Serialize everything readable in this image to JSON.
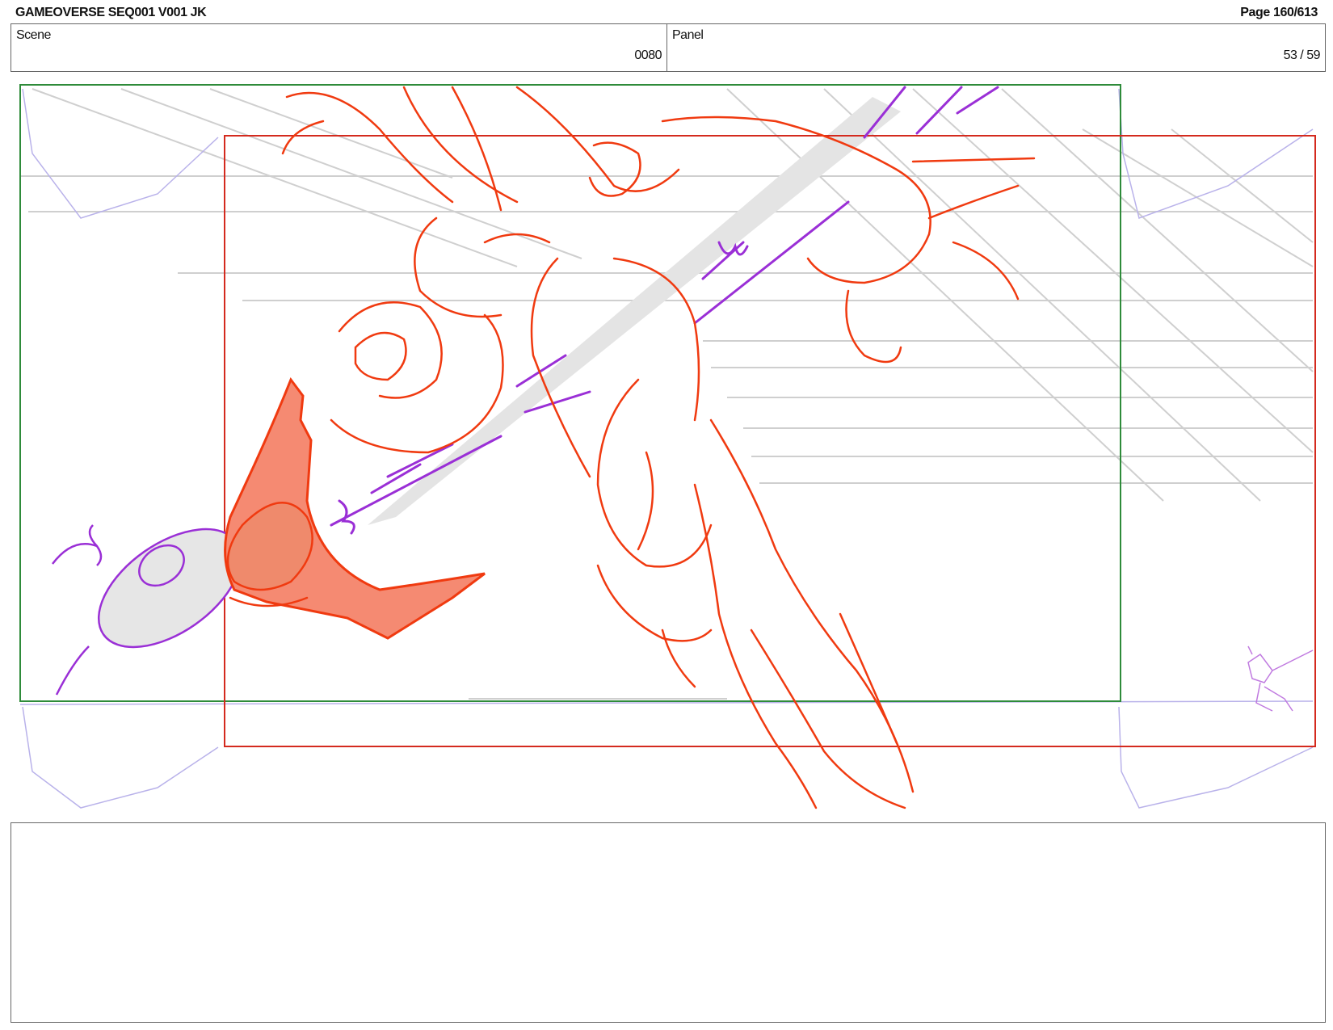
{
  "header": {
    "title": "GAMEOVERSE SEQ001 V001 JK",
    "page": "Page 160/613"
  },
  "info": {
    "scene_label": "Scene",
    "scene_value": "0080",
    "panel_label": "Panel",
    "panel_value": "53 / 59"
  },
  "panel": {
    "description_text": ""
  },
  "colors": {
    "camera_frame": "#2e8b3a",
    "field_frame": "#d42a1e",
    "sketch_red": "#f03a10",
    "sketch_fill": "#f58a72",
    "sketch_purple": "#9a2fd6",
    "background_lines": "#c9c9c9",
    "guide_lines": "#b8b0e8"
  }
}
